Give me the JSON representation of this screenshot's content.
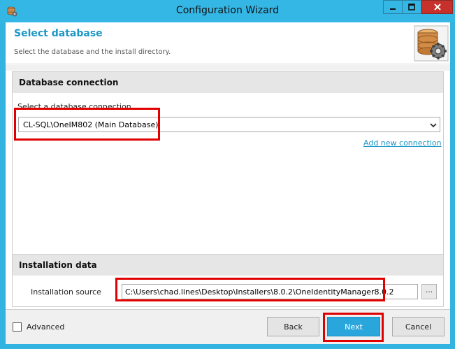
{
  "window": {
    "title": "Configuration Wizard"
  },
  "header": {
    "title": "Select database",
    "subtitle": "Select the database and the install directory."
  },
  "database_connection": {
    "heading": "Database connection",
    "field_label": "Select a database connection",
    "selected_value": "CL-SQL\\OneIM802 (Main Database)",
    "add_link": "Add new connection"
  },
  "installation_data": {
    "heading": "Installation data",
    "source_label": "Installation source",
    "source_value": "C:\\Users\\chad.lines\\Desktop\\Installers\\8.0.2\\OneIdentityManager8.0.2",
    "browse_label": "..."
  },
  "footer": {
    "advanced_label": "Advanced",
    "advanced_checked": false,
    "back_label": "Back",
    "next_label": "Next",
    "cancel_label": "Cancel"
  },
  "colors": {
    "titlebar": "#35b7e6",
    "accent": "#1c97c6",
    "next_button": "#29a7dd",
    "close_button": "#c7312b",
    "highlight": "#e00000"
  }
}
